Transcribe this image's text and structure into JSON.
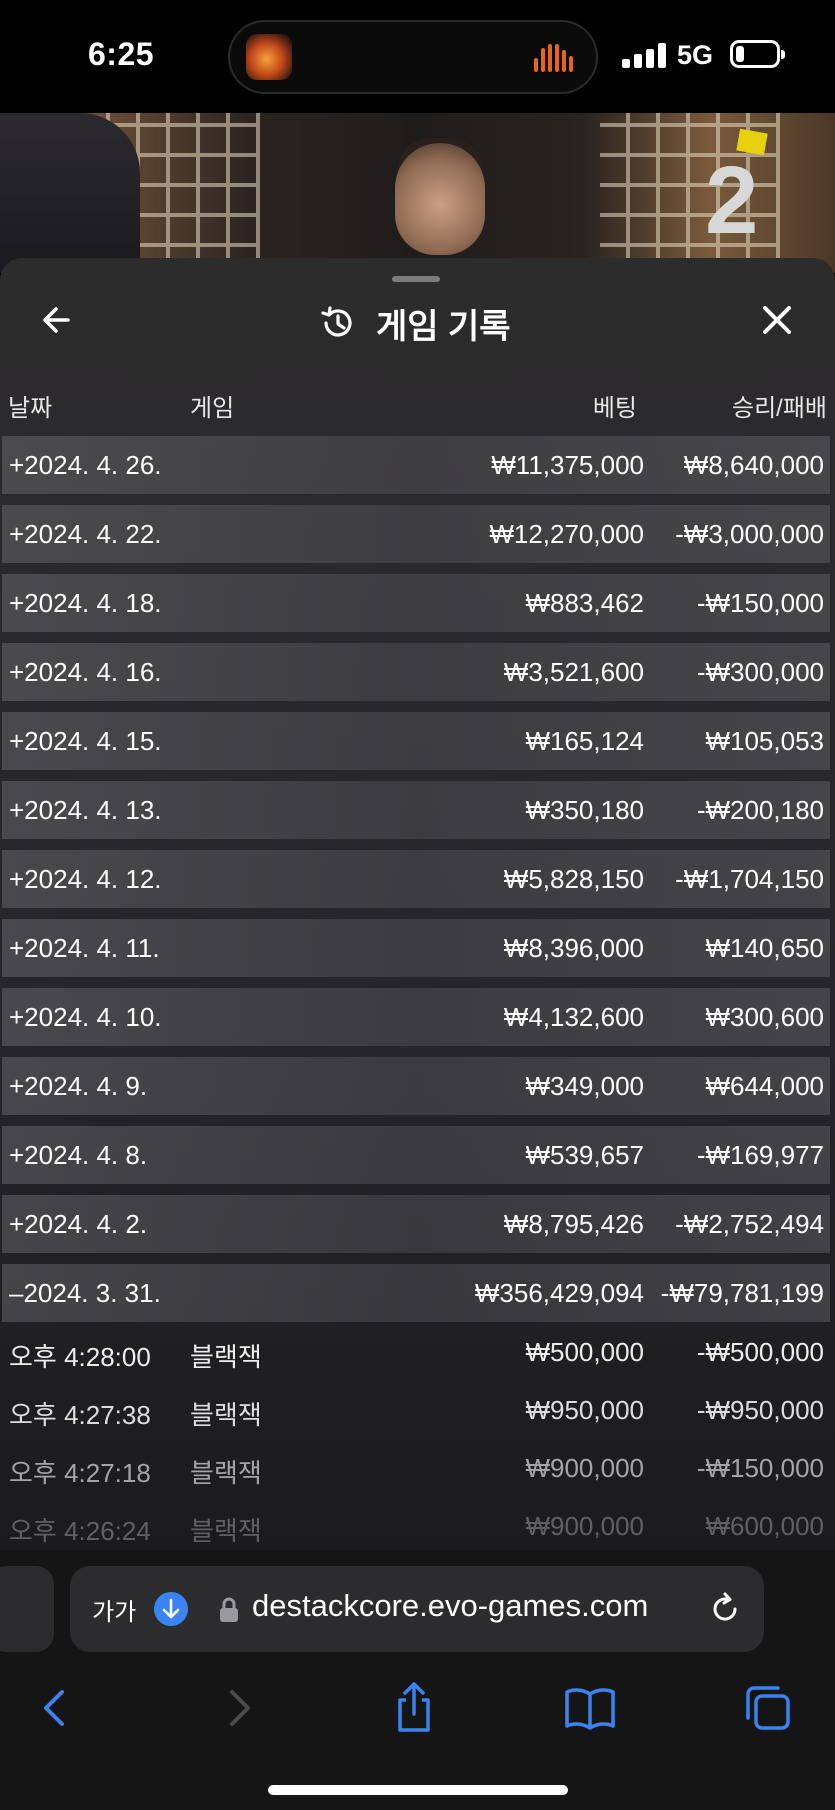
{
  "status": {
    "time": "6:25",
    "network": "5G"
  },
  "video": {
    "round_number": "2"
  },
  "panel": {
    "title": "게임 기록",
    "columns": {
      "date": "날짜",
      "game": "게임",
      "bet": "베팅",
      "result": "승리/패배"
    },
    "rows": [
      {
        "date": "+2024. 4. 26.",
        "bet": "₩11,375,000",
        "result": "₩8,640,000"
      },
      {
        "date": "+2024. 4. 22.",
        "bet": "₩12,270,000",
        "result": "-₩3,000,000"
      },
      {
        "date": "+2024. 4. 18.",
        "bet": "₩883,462",
        "result": "-₩150,000"
      },
      {
        "date": "+2024. 4. 16.",
        "bet": "₩3,521,600",
        "result": "-₩300,000"
      },
      {
        "date": "+2024. 4. 15.",
        "bet": "₩165,124",
        "result": "₩105,053"
      },
      {
        "date": "+2024. 4. 13.",
        "bet": "₩350,180",
        "result": "-₩200,180"
      },
      {
        "date": "+2024. 4. 12.",
        "bet": "₩5,828,150",
        "result": "-₩1,704,150"
      },
      {
        "date": "+2024. 4. 11.",
        "bet": "₩8,396,000",
        "result": "₩140,650"
      },
      {
        "date": "+2024. 4. 10.",
        "bet": "₩4,132,600",
        "result": "₩300,600"
      },
      {
        "date": "+2024. 4. 9.",
        "bet": "₩349,000",
        "result": "₩644,000"
      },
      {
        "date": "+2024. 4. 8.",
        "bet": "₩539,657",
        "result": "-₩169,977"
      },
      {
        "date": "+2024. 4. 2.",
        "bet": "₩8,795,426",
        "result": "-₩2,752,494"
      },
      {
        "date": "–2024. 3. 31.",
        "bet": "₩356,429,094",
        "result": "-₩79,781,199"
      }
    ],
    "subrows": [
      {
        "time": "오후 4:28:00",
        "game": "블랙잭",
        "bet": "₩500,000",
        "result": "-₩500,000"
      },
      {
        "time": "오후 4:27:38",
        "game": "블랙잭",
        "bet": "₩950,000",
        "result": "-₩950,000"
      },
      {
        "time": "오후 4:27:18",
        "game": "블랙잭",
        "bet": "₩900,000",
        "result": "-₩150,000"
      },
      {
        "time": "오후 4:26:24",
        "game": "블랙잭",
        "bet": "₩900,000",
        "result": "₩600,000"
      }
    ]
  },
  "browser": {
    "aa_label": "가가",
    "url": "destackcore.evo-games.com"
  },
  "colors": {
    "accent": "#3a83f1",
    "island_wave": "#e8631c"
  }
}
